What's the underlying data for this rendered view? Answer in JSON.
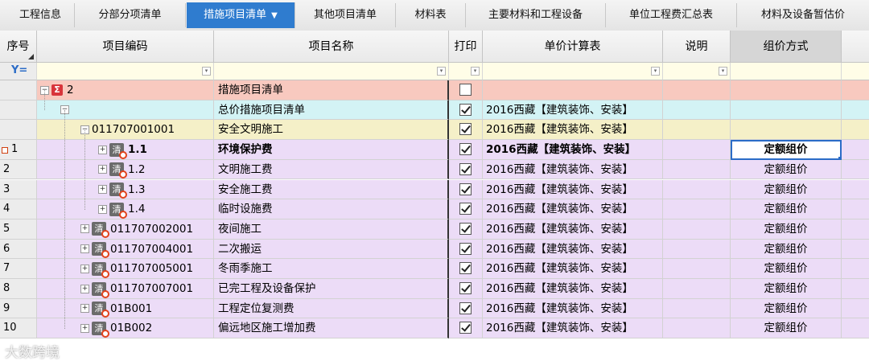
{
  "tabs": [
    {
      "label": "工程信息",
      "active": false
    },
    {
      "label": "分部分项清单",
      "active": false
    },
    {
      "label": "措施项目清单",
      "active": true
    },
    {
      "label": "其他项目清单",
      "active": false
    },
    {
      "label": "材料表",
      "active": false
    },
    {
      "label": "主要材料和工程设备",
      "active": false
    },
    {
      "label": "单位工程费汇总表",
      "active": false
    },
    {
      "label": "材料及设备暂估价",
      "active": false
    }
  ],
  "columns": {
    "seq": "序号",
    "code": "项目编码",
    "name": "项目名称",
    "print": "打印",
    "calc": "单价计算表",
    "desc": "说明",
    "method": "组价方式"
  },
  "rows": [
    {
      "seq": "",
      "code": "2",
      "name": "措施项目清单",
      "print": false,
      "calc": "",
      "method": ""
    },
    {
      "seq": "",
      "code": "",
      "name": "总价措施项目清单",
      "print": true,
      "calc": "2016西藏【建筑装饰、安装】",
      "method": ""
    },
    {
      "seq": "",
      "code": "011707001001",
      "name": "安全文明施工",
      "print": true,
      "calc": "2016西藏【建筑装饰、安装】",
      "method": ""
    },
    {
      "seq": "1",
      "code": "1.1",
      "name": "环境保护费",
      "print": true,
      "calc": "2016西藏【建筑装饰、安装】",
      "method": "定额组价"
    },
    {
      "seq": "2",
      "code": "1.2",
      "name": "文明施工费",
      "print": true,
      "calc": "2016西藏【建筑装饰、安装】",
      "method": "定额组价"
    },
    {
      "seq": "3",
      "code": "1.3",
      "name": "安全施工费",
      "print": true,
      "calc": "2016西藏【建筑装饰、安装】",
      "method": "定额组价"
    },
    {
      "seq": "4",
      "code": "1.4",
      "name": "临时设施费",
      "print": true,
      "calc": "2016西藏【建筑装饰、安装】",
      "method": "定额组价"
    },
    {
      "seq": "5",
      "code": "011707002001",
      "name": "夜间施工",
      "print": true,
      "calc": "2016西藏【建筑装饰、安装】",
      "method": "定额组价"
    },
    {
      "seq": "6",
      "code": "011707004001",
      "name": "二次搬运",
      "print": true,
      "calc": "2016西藏【建筑装饰、安装】",
      "method": "定额组价"
    },
    {
      "seq": "7",
      "code": "011707005001",
      "name": "冬雨季施工",
      "print": true,
      "calc": "2016西藏【建筑装饰、安装】",
      "method": "定额组价"
    },
    {
      "seq": "8",
      "code": "011707007001",
      "name": "已完工程及设备保护",
      "print": true,
      "calc": "2016西藏【建筑装饰、安装】",
      "method": "定额组价"
    },
    {
      "seq": "9",
      "code": "01B001",
      "name": "工程定位复测费",
      "print": true,
      "calc": "2016西藏【建筑装饰、安装】",
      "method": "定额组价"
    },
    {
      "seq": "10",
      "code": "01B002",
      "name": "偏远地区施工增加费",
      "print": true,
      "calc": "2016西藏【建筑装饰、安装】",
      "method": "定额组价"
    }
  ],
  "icons": {
    "sigma": "Σ",
    "quota": "清"
  },
  "watermark": "大数跨境",
  "colors": {
    "tab_active": "#2f7ccf",
    "row_root": "#f8c9bf",
    "row_sub": "#d3f3f5",
    "row_group": "#f5f0c8",
    "row_item": "#ecdcf7",
    "selection": "#2b6cc7"
  }
}
